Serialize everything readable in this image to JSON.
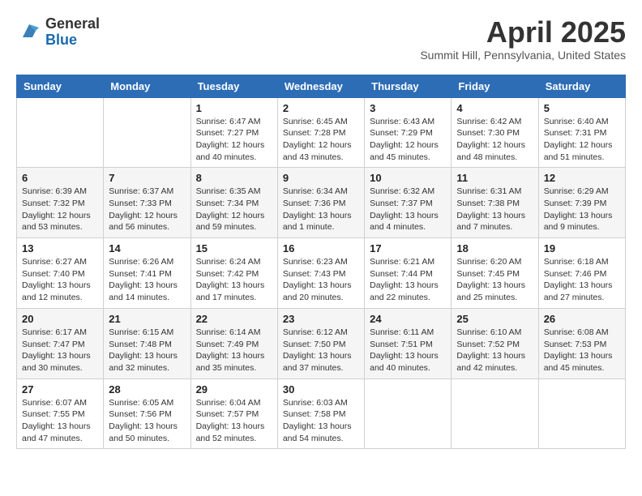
{
  "header": {
    "logo_general": "General",
    "logo_blue": "Blue",
    "month": "April 2025",
    "location": "Summit Hill, Pennsylvania, United States"
  },
  "days_of_week": [
    "Sunday",
    "Monday",
    "Tuesday",
    "Wednesday",
    "Thursday",
    "Friday",
    "Saturday"
  ],
  "weeks": [
    [
      {
        "day": "",
        "info": ""
      },
      {
        "day": "",
        "info": ""
      },
      {
        "day": "1",
        "info": "Sunrise: 6:47 AM\nSunset: 7:27 PM\nDaylight: 12 hours and 40 minutes."
      },
      {
        "day": "2",
        "info": "Sunrise: 6:45 AM\nSunset: 7:28 PM\nDaylight: 12 hours and 43 minutes."
      },
      {
        "day": "3",
        "info": "Sunrise: 6:43 AM\nSunset: 7:29 PM\nDaylight: 12 hours and 45 minutes."
      },
      {
        "day": "4",
        "info": "Sunrise: 6:42 AM\nSunset: 7:30 PM\nDaylight: 12 hours and 48 minutes."
      },
      {
        "day": "5",
        "info": "Sunrise: 6:40 AM\nSunset: 7:31 PM\nDaylight: 12 hours and 51 minutes."
      }
    ],
    [
      {
        "day": "6",
        "info": "Sunrise: 6:39 AM\nSunset: 7:32 PM\nDaylight: 12 hours and 53 minutes."
      },
      {
        "day": "7",
        "info": "Sunrise: 6:37 AM\nSunset: 7:33 PM\nDaylight: 12 hours and 56 minutes."
      },
      {
        "day": "8",
        "info": "Sunrise: 6:35 AM\nSunset: 7:34 PM\nDaylight: 12 hours and 59 minutes."
      },
      {
        "day": "9",
        "info": "Sunrise: 6:34 AM\nSunset: 7:36 PM\nDaylight: 13 hours and 1 minute."
      },
      {
        "day": "10",
        "info": "Sunrise: 6:32 AM\nSunset: 7:37 PM\nDaylight: 13 hours and 4 minutes."
      },
      {
        "day": "11",
        "info": "Sunrise: 6:31 AM\nSunset: 7:38 PM\nDaylight: 13 hours and 7 minutes."
      },
      {
        "day": "12",
        "info": "Sunrise: 6:29 AM\nSunset: 7:39 PM\nDaylight: 13 hours and 9 minutes."
      }
    ],
    [
      {
        "day": "13",
        "info": "Sunrise: 6:27 AM\nSunset: 7:40 PM\nDaylight: 13 hours and 12 minutes."
      },
      {
        "day": "14",
        "info": "Sunrise: 6:26 AM\nSunset: 7:41 PM\nDaylight: 13 hours and 14 minutes."
      },
      {
        "day": "15",
        "info": "Sunrise: 6:24 AM\nSunset: 7:42 PM\nDaylight: 13 hours and 17 minutes."
      },
      {
        "day": "16",
        "info": "Sunrise: 6:23 AM\nSunset: 7:43 PM\nDaylight: 13 hours and 20 minutes."
      },
      {
        "day": "17",
        "info": "Sunrise: 6:21 AM\nSunset: 7:44 PM\nDaylight: 13 hours and 22 minutes."
      },
      {
        "day": "18",
        "info": "Sunrise: 6:20 AM\nSunset: 7:45 PM\nDaylight: 13 hours and 25 minutes."
      },
      {
        "day": "19",
        "info": "Sunrise: 6:18 AM\nSunset: 7:46 PM\nDaylight: 13 hours and 27 minutes."
      }
    ],
    [
      {
        "day": "20",
        "info": "Sunrise: 6:17 AM\nSunset: 7:47 PM\nDaylight: 13 hours and 30 minutes."
      },
      {
        "day": "21",
        "info": "Sunrise: 6:15 AM\nSunset: 7:48 PM\nDaylight: 13 hours and 32 minutes."
      },
      {
        "day": "22",
        "info": "Sunrise: 6:14 AM\nSunset: 7:49 PM\nDaylight: 13 hours and 35 minutes."
      },
      {
        "day": "23",
        "info": "Sunrise: 6:12 AM\nSunset: 7:50 PM\nDaylight: 13 hours and 37 minutes."
      },
      {
        "day": "24",
        "info": "Sunrise: 6:11 AM\nSunset: 7:51 PM\nDaylight: 13 hours and 40 minutes."
      },
      {
        "day": "25",
        "info": "Sunrise: 6:10 AM\nSunset: 7:52 PM\nDaylight: 13 hours and 42 minutes."
      },
      {
        "day": "26",
        "info": "Sunrise: 6:08 AM\nSunset: 7:53 PM\nDaylight: 13 hours and 45 minutes."
      }
    ],
    [
      {
        "day": "27",
        "info": "Sunrise: 6:07 AM\nSunset: 7:55 PM\nDaylight: 13 hours and 47 minutes."
      },
      {
        "day": "28",
        "info": "Sunrise: 6:05 AM\nSunset: 7:56 PM\nDaylight: 13 hours and 50 minutes."
      },
      {
        "day": "29",
        "info": "Sunrise: 6:04 AM\nSunset: 7:57 PM\nDaylight: 13 hours and 52 minutes."
      },
      {
        "day": "30",
        "info": "Sunrise: 6:03 AM\nSunset: 7:58 PM\nDaylight: 13 hours and 54 minutes."
      },
      {
        "day": "",
        "info": ""
      },
      {
        "day": "",
        "info": ""
      },
      {
        "day": "",
        "info": ""
      }
    ]
  ]
}
